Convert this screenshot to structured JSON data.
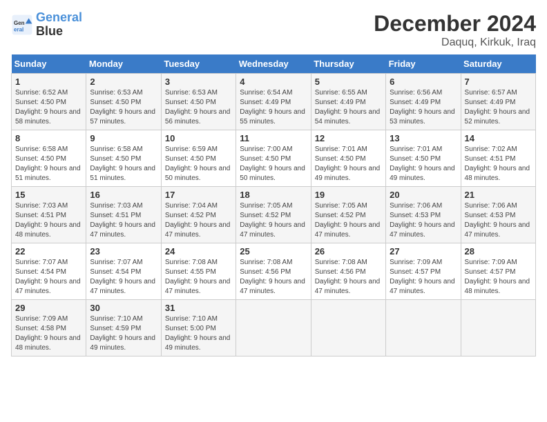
{
  "logo": {
    "line1": "General",
    "line2": "Blue"
  },
  "title": "December 2024",
  "subtitle": "Daquq, Kirkuk, Iraq",
  "weekdays": [
    "Sunday",
    "Monday",
    "Tuesday",
    "Wednesday",
    "Thursday",
    "Friday",
    "Saturday"
  ],
  "weeks": [
    [
      {
        "day": "1",
        "sunrise": "6:52 AM",
        "sunset": "4:50 PM",
        "daylight": "9 hours and 58 minutes."
      },
      {
        "day": "2",
        "sunrise": "6:53 AM",
        "sunset": "4:50 PM",
        "daylight": "9 hours and 57 minutes."
      },
      {
        "day": "3",
        "sunrise": "6:53 AM",
        "sunset": "4:50 PM",
        "daylight": "9 hours and 56 minutes."
      },
      {
        "day": "4",
        "sunrise": "6:54 AM",
        "sunset": "4:49 PM",
        "daylight": "9 hours and 55 minutes."
      },
      {
        "day": "5",
        "sunrise": "6:55 AM",
        "sunset": "4:49 PM",
        "daylight": "9 hours and 54 minutes."
      },
      {
        "day": "6",
        "sunrise": "6:56 AM",
        "sunset": "4:49 PM",
        "daylight": "9 hours and 53 minutes."
      },
      {
        "day": "7",
        "sunrise": "6:57 AM",
        "sunset": "4:49 PM",
        "daylight": "9 hours and 52 minutes."
      }
    ],
    [
      {
        "day": "8",
        "sunrise": "6:58 AM",
        "sunset": "4:50 PM",
        "daylight": "9 hours and 51 minutes."
      },
      {
        "day": "9",
        "sunrise": "6:58 AM",
        "sunset": "4:50 PM",
        "daylight": "9 hours and 51 minutes."
      },
      {
        "day": "10",
        "sunrise": "6:59 AM",
        "sunset": "4:50 PM",
        "daylight": "9 hours and 50 minutes."
      },
      {
        "day": "11",
        "sunrise": "7:00 AM",
        "sunset": "4:50 PM",
        "daylight": "9 hours and 50 minutes."
      },
      {
        "day": "12",
        "sunrise": "7:01 AM",
        "sunset": "4:50 PM",
        "daylight": "9 hours and 49 minutes."
      },
      {
        "day": "13",
        "sunrise": "7:01 AM",
        "sunset": "4:50 PM",
        "daylight": "9 hours and 49 minutes."
      },
      {
        "day": "14",
        "sunrise": "7:02 AM",
        "sunset": "4:51 PM",
        "daylight": "9 hours and 48 minutes."
      }
    ],
    [
      {
        "day": "15",
        "sunrise": "7:03 AM",
        "sunset": "4:51 PM",
        "daylight": "9 hours and 48 minutes."
      },
      {
        "day": "16",
        "sunrise": "7:03 AM",
        "sunset": "4:51 PM",
        "daylight": "9 hours and 47 minutes."
      },
      {
        "day": "17",
        "sunrise": "7:04 AM",
        "sunset": "4:52 PM",
        "daylight": "9 hours and 47 minutes."
      },
      {
        "day": "18",
        "sunrise": "7:05 AM",
        "sunset": "4:52 PM",
        "daylight": "9 hours and 47 minutes."
      },
      {
        "day": "19",
        "sunrise": "7:05 AM",
        "sunset": "4:52 PM",
        "daylight": "9 hours and 47 minutes."
      },
      {
        "day": "20",
        "sunrise": "7:06 AM",
        "sunset": "4:53 PM",
        "daylight": "9 hours and 47 minutes."
      },
      {
        "day": "21",
        "sunrise": "7:06 AM",
        "sunset": "4:53 PM",
        "daylight": "9 hours and 47 minutes."
      }
    ],
    [
      {
        "day": "22",
        "sunrise": "7:07 AM",
        "sunset": "4:54 PM",
        "daylight": "9 hours and 47 minutes."
      },
      {
        "day": "23",
        "sunrise": "7:07 AM",
        "sunset": "4:54 PM",
        "daylight": "9 hours and 47 minutes."
      },
      {
        "day": "24",
        "sunrise": "7:08 AM",
        "sunset": "4:55 PM",
        "daylight": "9 hours and 47 minutes."
      },
      {
        "day": "25",
        "sunrise": "7:08 AM",
        "sunset": "4:56 PM",
        "daylight": "9 hours and 47 minutes."
      },
      {
        "day": "26",
        "sunrise": "7:08 AM",
        "sunset": "4:56 PM",
        "daylight": "9 hours and 47 minutes."
      },
      {
        "day": "27",
        "sunrise": "7:09 AM",
        "sunset": "4:57 PM",
        "daylight": "9 hours and 47 minutes."
      },
      {
        "day": "28",
        "sunrise": "7:09 AM",
        "sunset": "4:57 PM",
        "daylight": "9 hours and 48 minutes."
      }
    ],
    [
      {
        "day": "29",
        "sunrise": "7:09 AM",
        "sunset": "4:58 PM",
        "daylight": "9 hours and 48 minutes."
      },
      {
        "day": "30",
        "sunrise": "7:10 AM",
        "sunset": "4:59 PM",
        "daylight": "9 hours and 49 minutes."
      },
      {
        "day": "31",
        "sunrise": "7:10 AM",
        "sunset": "5:00 PM",
        "daylight": "9 hours and 49 minutes."
      },
      null,
      null,
      null,
      null
    ]
  ]
}
